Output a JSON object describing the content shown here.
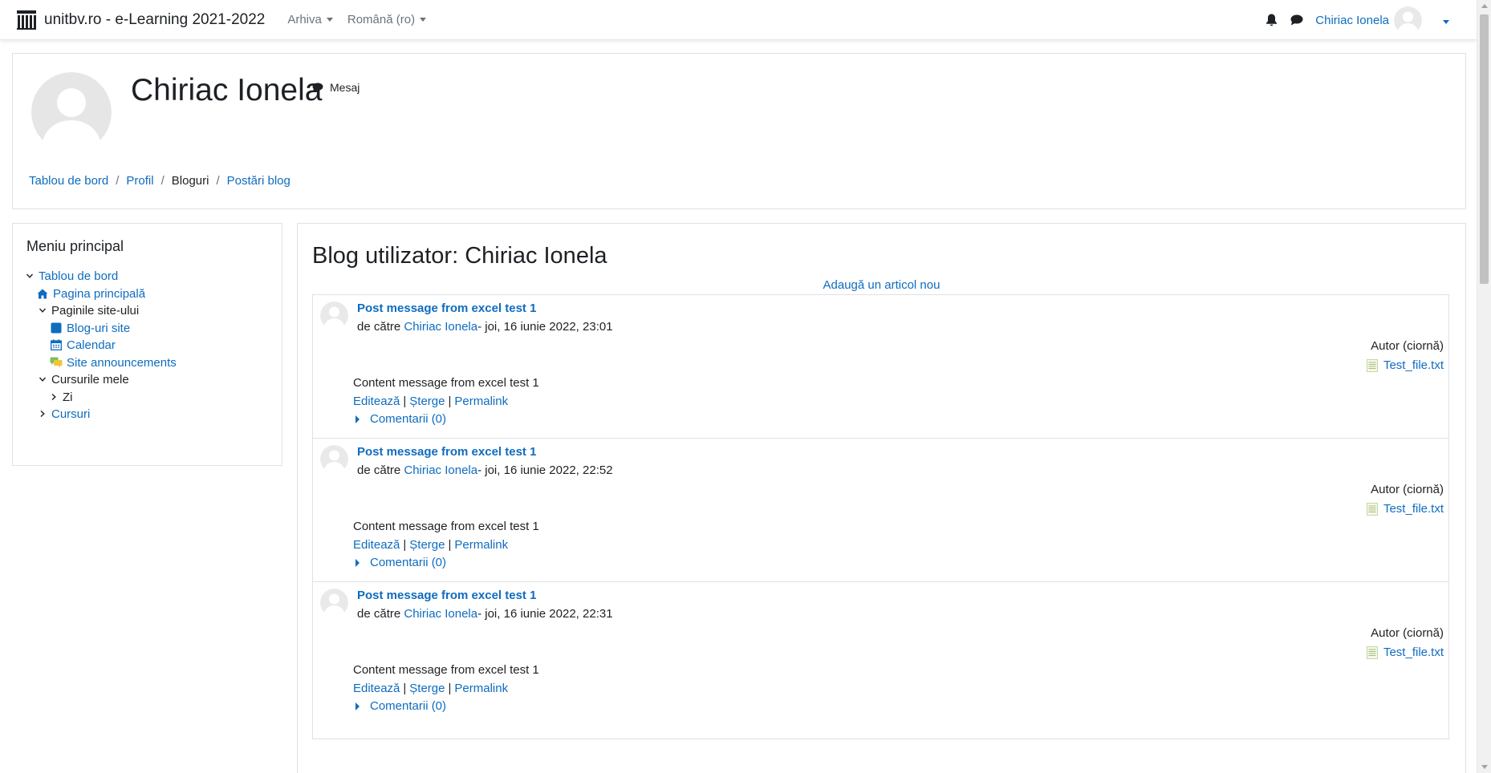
{
  "navbar": {
    "brand": "unitbv.ro - e-Learning 2021-2022",
    "menu": [
      "Arhiva",
      "Română (ro)"
    ],
    "user_name": "Chiriac Ionela",
    "icons": [
      "bell-icon",
      "chat-icon"
    ]
  },
  "header": {
    "name": "Chiriac Ionela",
    "message_label": "Mesaj",
    "breadcrumb": [
      "Tablou de bord",
      "Profil",
      "Bloguri",
      "Postări blog"
    ]
  },
  "sidebar": {
    "title": "Meniu principal",
    "items": [
      {
        "label": "Tablou de bord",
        "icon": "chevron-down"
      },
      {
        "label": "Pagina principală",
        "icon": "home-icon"
      },
      {
        "label": "Paginile site-ului",
        "icon": "chevron-down"
      },
      {
        "label": "Blog-uri site",
        "icon": "blog-icon"
      },
      {
        "label": "Calendar",
        "icon": "calendar-icon"
      },
      {
        "label": "Site announcements",
        "icon": "forum-icon"
      },
      {
        "label": "Cursurile mele",
        "icon": "chevron-down"
      },
      {
        "label": "Zi",
        "icon": "chevron-right"
      },
      {
        "label": "Cursuri",
        "icon": "chevron-right"
      }
    ]
  },
  "main": {
    "title": "Blog utilizator: Chiriac Ionela",
    "add_link": "Adaugă un articol nou",
    "posts": [
      {
        "title": "Post message from excel test 1",
        "by_prefix": "de către ",
        "author": "Chiriac Ionela",
        "date": "- joi, 16 iunie 2022, 23:01",
        "status": "Autor (ciornă)",
        "file": "Test_file.txt",
        "content": "Content message from excel test 1",
        "edit": "Editează",
        "delete": "Șterge",
        "permalink": "Permalink",
        "comments": "Comentarii (0)"
      },
      {
        "title": "Post message from excel test 1",
        "by_prefix": "de către ",
        "author": "Chiriac Ionela",
        "date": "- joi, 16 iunie 2022, 22:52",
        "status": "Autor (ciornă)",
        "file": "Test_file.txt",
        "content": "Content message from excel test 1",
        "edit": "Editează",
        "delete": "Șterge",
        "permalink": "Permalink",
        "comments": "Comentarii (0)"
      },
      {
        "title": "Post message from excel test 1",
        "by_prefix": "de către ",
        "author": "Chiriac Ionela",
        "date": "- joi, 16 iunie 2022, 22:31",
        "status": "Autor (ciornă)",
        "file": "Test_file.txt",
        "content": "Content message from excel test 1",
        "edit": "Editează",
        "delete": "Șterge",
        "permalink": "Permalink",
        "comments": "Comentarii (0)"
      }
    ]
  },
  "colors": {
    "link": "#0f6cbf",
    "text": "#1d2125",
    "muted": "#6a737b",
    "border": "#dee2e6"
  }
}
